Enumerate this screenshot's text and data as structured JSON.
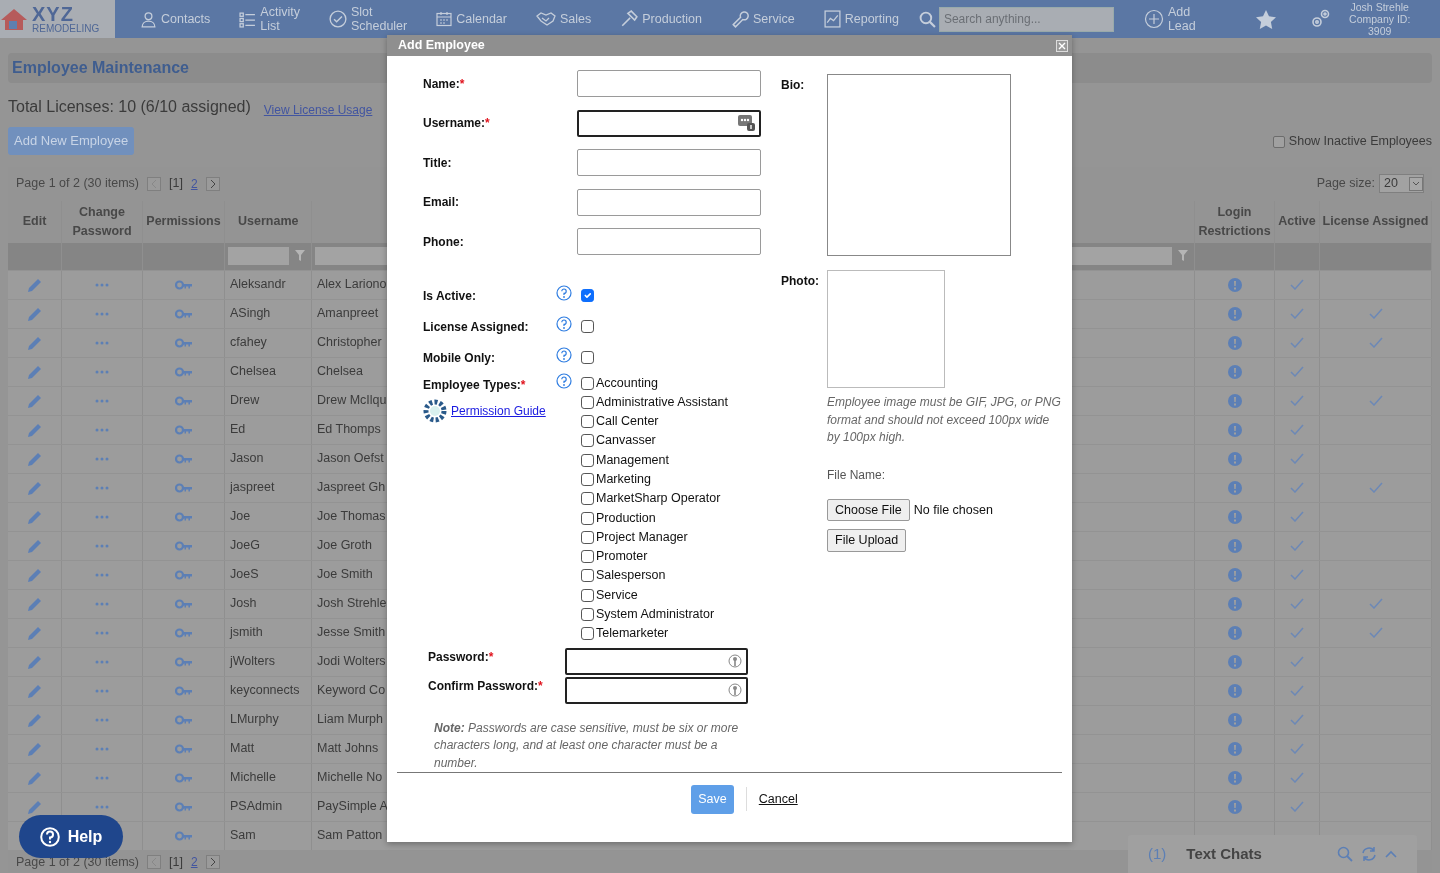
{
  "navbar": {
    "logo": {
      "main": "XYZ",
      "sub": "REMODELING"
    },
    "items": [
      {
        "label": "Contacts",
        "kind": "person"
      },
      {
        "label": "Activity List",
        "kind": "list"
      },
      {
        "label": "Slot Scheduler",
        "kind": "schedule"
      },
      {
        "label": "Calendar",
        "kind": "calendar"
      },
      {
        "label": "Sales",
        "kind": "sales"
      },
      {
        "label": "Production",
        "kind": "production"
      },
      {
        "label": "Service",
        "kind": "service"
      },
      {
        "label": "Reporting",
        "kind": "report"
      }
    ],
    "search": {
      "placeholder": "Search anything..."
    },
    "add_lead": "Add Lead",
    "user": {
      "name": "Josh Strehle",
      "company": "Company ID: 3909"
    }
  },
  "page": {
    "title": "Employee Maintenance",
    "licenses": "Total Licenses: 10 (6/10 assigned)",
    "license_link": "View License Usage",
    "add_button": "Add New Employee",
    "show_inactive": {
      "label": "Show Inactive Employees",
      "checked": false
    }
  },
  "grid": {
    "pager": {
      "summary": "Page 1 of 2 (30 items)",
      "pages": [
        {
          "label": "[1]",
          "selected": true
        },
        {
          "label": "2",
          "selected": false
        }
      ]
    },
    "page_size_label": "Page size:",
    "page_size": "20",
    "columns": [
      "Edit",
      "Change Password",
      "Permissions",
      "Username",
      "Login Restrictions",
      "Active",
      "License Assigned"
    ],
    "rows": [
      {
        "username": "Aleksandr",
        "name": "Alex Lariono",
        "active": true,
        "license_assigned": false
      },
      {
        "username": "ASingh",
        "name": "Amanpreet",
        "active": true,
        "license_assigned": true
      },
      {
        "username": "cfahey",
        "name": "Christopher",
        "active": true,
        "license_assigned": true
      },
      {
        "username": "Chelsea",
        "name": "Chelsea",
        "active": true,
        "license_assigned": false
      },
      {
        "username": "Drew",
        "name": "Drew McIlqu",
        "active": true,
        "license_assigned": true
      },
      {
        "username": "Ed",
        "name": "Ed Thomps",
        "active": true,
        "license_assigned": false
      },
      {
        "username": "Jason",
        "name": "Jason Oefst",
        "active": true,
        "license_assigned": false
      },
      {
        "username": "jaspreet",
        "name": "Jaspreet Gh",
        "active": true,
        "license_assigned": true
      },
      {
        "username": "Joe",
        "name": "Joe Thomas",
        "active": true,
        "license_assigned": false
      },
      {
        "username": "JoeG",
        "name": "Joe Groth",
        "active": true,
        "license_assigned": false
      },
      {
        "username": "JoeS",
        "name": "Joe Smith",
        "active": true,
        "license_assigned": false
      },
      {
        "username": "Josh",
        "name": "Josh Strehle",
        "active": true,
        "license_assigned": true
      },
      {
        "username": "jsmith",
        "name": "Jesse Smith",
        "active": true,
        "license_assigned": true
      },
      {
        "username": "jWolters",
        "name": "Jodi Wolters",
        "active": true,
        "license_assigned": false
      },
      {
        "username": "keyconnects",
        "name": "Keyword Co",
        "active": true,
        "license_assigned": false
      },
      {
        "username": "LMurphy",
        "name": "Liam Murph",
        "active": true,
        "license_assigned": false
      },
      {
        "username": "Matt",
        "name": "Matt Johns",
        "active": true,
        "license_assigned": false
      },
      {
        "username": "Michelle",
        "name": "Michelle No",
        "active": true,
        "license_assigned": false
      },
      {
        "username": "PSAdmin",
        "name": "PaySimple A",
        "active": true,
        "license_assigned": false
      },
      {
        "username": "Sam",
        "name": "Sam Patton",
        "covered": true
      }
    ],
    "footer_pager": {
      "summary": "Page 1 of 2 (30 items)",
      "pages": [
        {
          "label": "[1]",
          "selected": true
        },
        {
          "label": "2",
          "selected": false
        }
      ]
    }
  },
  "help_button": "Help",
  "text_chats": {
    "count": "(1)",
    "title": "Text Chats"
  },
  "dialog": {
    "title": "Add Employee",
    "fields": [
      {
        "label": "Name:",
        "asterisk": "*"
      },
      {
        "label": "Username:",
        "asterisk": "*",
        "kind": "username"
      },
      {
        "label": "Title:"
      },
      {
        "label": "Email:"
      },
      {
        "label": "Phone:"
      }
    ],
    "flags": [
      {
        "label": "Is Active:",
        "checked": true
      },
      {
        "label": "License Assigned:",
        "checked": false
      },
      {
        "label": "Mobile Only:",
        "checked": false
      }
    ],
    "employee_types": {
      "label": "Employee Types:",
      "asterisk": "*",
      "guide_link": "Permission Guide",
      "options": [
        {
          "label": "Accounting",
          "checked": false
        },
        {
          "label": "Administrative Assistant",
          "checked": false
        },
        {
          "label": "Call Center",
          "checked": false
        },
        {
          "label": "Canvasser",
          "checked": false
        },
        {
          "label": "Management",
          "checked": false
        },
        {
          "label": "Marketing",
          "checked": false
        },
        {
          "label": "MarketSharp Operator",
          "checked": false
        },
        {
          "label": "Production",
          "checked": false
        },
        {
          "label": "Project Manager",
          "checked": false
        },
        {
          "label": "Promoter",
          "checked": false
        },
        {
          "label": "Salesperson",
          "checked": false
        },
        {
          "label": "Service",
          "checked": false
        },
        {
          "label": "System Administrator",
          "checked": false
        },
        {
          "label": "Telemarketer",
          "checked": false
        }
      ]
    },
    "passwords": [
      {
        "label": "Password:",
        "asterisk": "*"
      },
      {
        "label": "Confirm Password:",
        "asterisk": "*"
      }
    ],
    "note": "**Note:** Passwords are case sensitive, must be six or more characters long, and at least one character must be a number.",
    "bio_label": "Bio:",
    "photo_label": "Photo:",
    "photo_hint": "Employee image must be GIF, JPG, or PNG format and should not exceed 100px wide by 100px high.",
    "file_name_label": "File Name:",
    "choose_file": "Choose File",
    "no_file": "No file chosen",
    "upload": "File Upload",
    "save": "Save",
    "cancel": "Cancel"
  }
}
